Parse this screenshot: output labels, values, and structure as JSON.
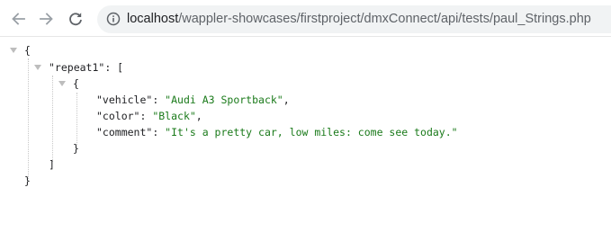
{
  "browser": {
    "url_host": "localhost",
    "url_path": "/wappler-showcases/firstproject/dmxConnect/api/tests/paul_Strings.php"
  },
  "json_viewer": {
    "open_brace": "{",
    "close_brace": "}",
    "repeat_key": "\"repeat1\"",
    "colon": ": ",
    "open_bracket": "[",
    "close_bracket": "]",
    "item_open": "{",
    "item_close": "}",
    "fields": [
      {
        "key": "\"vehicle\"",
        "value": "\"Audi A3 Sportback\"",
        "sep": ","
      },
      {
        "key": "\"color\"",
        "value": "\"Black\"",
        "sep": ","
      },
      {
        "key": "\"comment\"",
        "value": "\"It's a pretty car, low miles: come see today.\"",
        "sep": ""
      }
    ]
  }
}
